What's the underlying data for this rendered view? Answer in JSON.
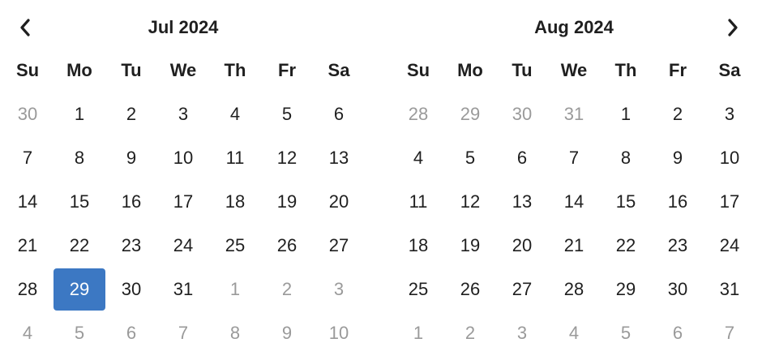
{
  "colors": {
    "selected_bg": "#3c78c3",
    "text": "#1f1f1f",
    "outside_text": "#9a9a9a"
  },
  "nav": {
    "prev_icon": "chevron-left-icon",
    "next_icon": "chevron-right-icon"
  },
  "weekdays": [
    "Su",
    "Mo",
    "Tu",
    "We",
    "Th",
    "Fr",
    "Sa"
  ],
  "months": [
    {
      "title": "Jul 2024",
      "days": [
        {
          "label": "30",
          "outside": true
        },
        {
          "label": "1"
        },
        {
          "label": "2"
        },
        {
          "label": "3"
        },
        {
          "label": "4"
        },
        {
          "label": "5"
        },
        {
          "label": "6"
        },
        {
          "label": "7"
        },
        {
          "label": "8"
        },
        {
          "label": "9"
        },
        {
          "label": "10"
        },
        {
          "label": "11"
        },
        {
          "label": "12"
        },
        {
          "label": "13"
        },
        {
          "label": "14"
        },
        {
          "label": "15"
        },
        {
          "label": "16"
        },
        {
          "label": "17"
        },
        {
          "label": "18"
        },
        {
          "label": "19"
        },
        {
          "label": "20"
        },
        {
          "label": "21"
        },
        {
          "label": "22"
        },
        {
          "label": "23"
        },
        {
          "label": "24"
        },
        {
          "label": "25"
        },
        {
          "label": "26"
        },
        {
          "label": "27"
        },
        {
          "label": "28"
        },
        {
          "label": "29",
          "selected": true
        },
        {
          "label": "30"
        },
        {
          "label": "31"
        },
        {
          "label": "1",
          "outside": true
        },
        {
          "label": "2",
          "outside": true
        },
        {
          "label": "3",
          "outside": true
        },
        {
          "label": "4",
          "outside": true
        },
        {
          "label": "5",
          "outside": true
        },
        {
          "label": "6",
          "outside": true
        },
        {
          "label": "7",
          "outside": true
        },
        {
          "label": "8",
          "outside": true
        },
        {
          "label": "9",
          "outside": true
        },
        {
          "label": "10",
          "outside": true
        }
      ]
    },
    {
      "title": "Aug 2024",
      "days": [
        {
          "label": "28",
          "outside": true
        },
        {
          "label": "29",
          "outside": true
        },
        {
          "label": "30",
          "outside": true
        },
        {
          "label": "31",
          "outside": true
        },
        {
          "label": "1"
        },
        {
          "label": "2"
        },
        {
          "label": "3"
        },
        {
          "label": "4"
        },
        {
          "label": "5"
        },
        {
          "label": "6"
        },
        {
          "label": "7"
        },
        {
          "label": "8"
        },
        {
          "label": "9"
        },
        {
          "label": "10"
        },
        {
          "label": "11"
        },
        {
          "label": "12"
        },
        {
          "label": "13"
        },
        {
          "label": "14"
        },
        {
          "label": "15"
        },
        {
          "label": "16"
        },
        {
          "label": "17"
        },
        {
          "label": "18"
        },
        {
          "label": "19"
        },
        {
          "label": "20"
        },
        {
          "label": "21"
        },
        {
          "label": "22"
        },
        {
          "label": "23"
        },
        {
          "label": "24"
        },
        {
          "label": "25"
        },
        {
          "label": "26"
        },
        {
          "label": "27"
        },
        {
          "label": "28"
        },
        {
          "label": "29"
        },
        {
          "label": "30"
        },
        {
          "label": "31"
        },
        {
          "label": "1",
          "outside": true
        },
        {
          "label": "2",
          "outside": true
        },
        {
          "label": "3",
          "outside": true
        },
        {
          "label": "4",
          "outside": true
        },
        {
          "label": "5",
          "outside": true
        },
        {
          "label": "6",
          "outside": true
        },
        {
          "label": "7",
          "outside": true
        }
      ]
    }
  ]
}
